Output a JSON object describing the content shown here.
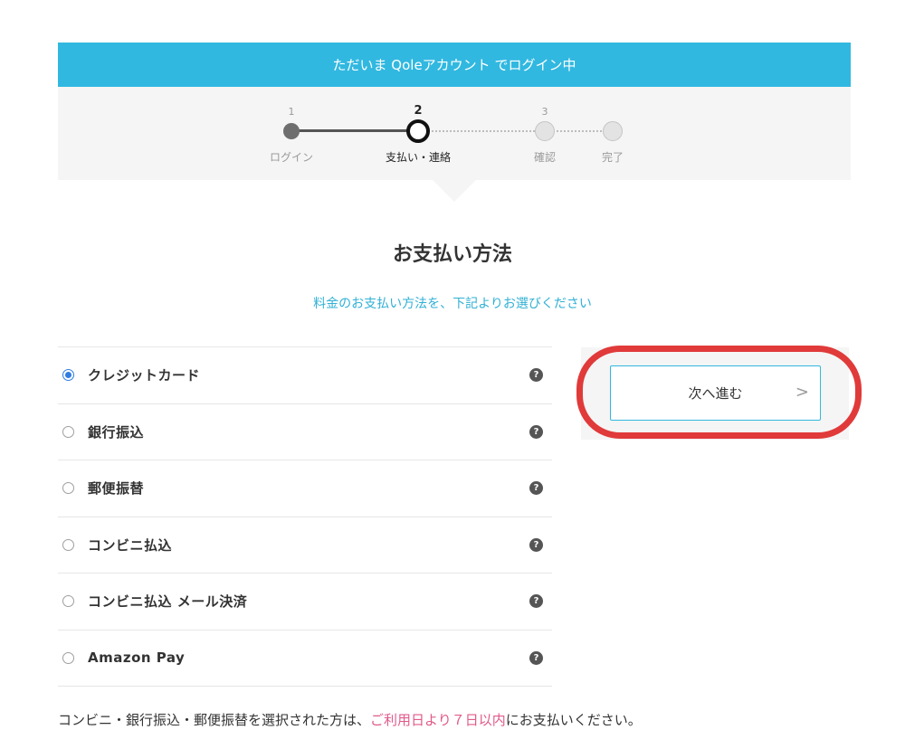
{
  "banner": {
    "text": "ただいま Qoleアカウント でログイン中"
  },
  "steps": [
    {
      "number": "1",
      "label": "ログイン",
      "state": "done"
    },
    {
      "number": "2",
      "label": "支払い・連絡",
      "state": "current"
    },
    {
      "number": "3",
      "label": "確認",
      "state": "todo"
    },
    {
      "number": "",
      "label": "完了",
      "state": "todo"
    }
  ],
  "payment": {
    "title": "お支払い方法",
    "subtitle": "料金のお支払い方法を、下記よりお選びください",
    "methods": [
      {
        "label": "クレジットカード",
        "checked": true
      },
      {
        "label": "銀行振込",
        "checked": false
      },
      {
        "label": "郵便振替",
        "checked": false
      },
      {
        "label": "コンビニ払込",
        "checked": false
      },
      {
        "label": "コンビニ払込 メール決済",
        "checked": false
      },
      {
        "label": "Amazon Pay",
        "checked": false
      }
    ],
    "help_glyph": "?",
    "selected_radio_color": "#2f7de1"
  },
  "actions": {
    "next_label": "次へ進む",
    "next_chevron": ">"
  },
  "note": {
    "prefix": "コンビニ・銀行振込・郵便振替を選択された方は、",
    "emphasis": "ご利用日より７日以内",
    "suffix": "にお支払いください。",
    "emphasis_color": "#e05a8a"
  },
  "colors": {
    "accent": "#31b8e0",
    "highlight_ring": "#e03a3a"
  }
}
